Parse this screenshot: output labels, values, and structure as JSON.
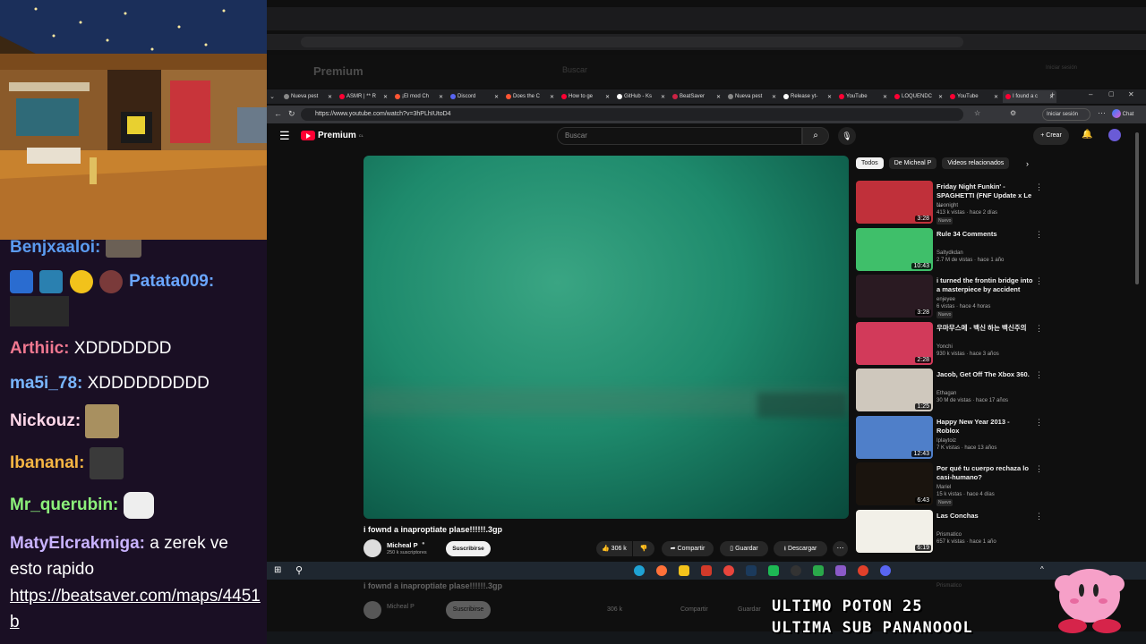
{
  "chat": {
    "messages": [
      {
        "user": "Benjxaaloi:",
        "color": "#5b9bf0",
        "text": ""
      },
      {
        "user": "Patata009:",
        "color": "#6aa6ff",
        "text": ""
      },
      {
        "user": "Arthiic:",
        "color": "#f07890",
        "text": "XDDDDDDD"
      },
      {
        "user": "ma5i_78:",
        "color": "#79b6ff",
        "text": "XDDDDDDDDD"
      },
      {
        "user": "Nickouz:",
        "color": "#ffd6e8",
        "text": ""
      },
      {
        "user": "Ibananal:",
        "color": "#f5b543",
        "text": ""
      },
      {
        "user": "Mr_querubin:",
        "color": "#8cf07a",
        "text": ""
      },
      {
        "user": "MatyElcrakmiga:",
        "color": "#c9b3ff",
        "text": "a zerek ve esto rapido"
      }
    ],
    "link": "https://beatsaver.com/maps/4451b"
  },
  "browser": {
    "tabs": [
      {
        "label": "Nueva pest",
        "color": "#888888"
      },
      {
        "label": "ASMR | ** R",
        "color": "#ff0033"
      },
      {
        "label": "¡El mod Ch",
        "color": "#ff5533"
      },
      {
        "label": "Discord",
        "color": "#5865f2"
      },
      {
        "label": "Does the C",
        "color": "#ff5533"
      },
      {
        "label": "How to ge",
        "color": "#ff0033"
      },
      {
        "label": "GitHub - Ks",
        "color": "#ffffff"
      },
      {
        "label": "BeatSaver",
        "color": "#cc2244"
      },
      {
        "label": "Nueva pest",
        "color": "#888888"
      },
      {
        "label": "Release yt-",
        "color": "#ffffff"
      },
      {
        "label": "YouTube",
        "color": "#ff0033"
      },
      {
        "label": "LOQUENDC",
        "color": "#ff0033"
      },
      {
        "label": "YouTube",
        "color": "#ff0033"
      },
      {
        "label": "I found a c",
        "color": "#ff0033"
      }
    ],
    "url": "https://www.youtube.com/watch?v=3hPLhIUtoD4",
    "signin_label": "Iniciar sesión",
    "chat_label": "Chat"
  },
  "youtube": {
    "logo_text": "Premium",
    "logo_sup": "CL",
    "search_placeholder": "Buscar",
    "create_label": "Crear",
    "video_title": "i fownd a inaproptiate plase!!!!!!.3gp",
    "channel": "Micheal P",
    "subscribers": "250 k suscriptores",
    "subscribe_label": "Suscribirse",
    "likes": "306 k",
    "share_label": "Compartir",
    "save_label": "Guardar",
    "download_label": "Descargar",
    "chips": [
      "Todos",
      "De Micheal P",
      "Videos relacionados"
    ],
    "recommendations": [
      {
        "title": "Friday Night Funkin' - SPAGHETTI (FNF Update x Le ...",
        "channel": "Neonight",
        "meta": "413 k vistas · hace 2 días",
        "duration": "3:28",
        "new": "Nuevo",
        "thumb": "#c0303a"
      },
      {
        "title": "Rule 34 Comments",
        "channel": "Saltydkdan",
        "meta": "2.7 M de vistas · hace 1 año",
        "duration": "10:43",
        "new": "",
        "thumb": "#3fbf6a"
      },
      {
        "title": "i turned the frontin bridge into a masterpiece by accident",
        "channel": "enjeyee",
        "meta": "6 vistas · hace 4 horas",
        "duration": "3:28",
        "new": "Nuevo",
        "thumb": "#2a1a22"
      },
      {
        "title": "우마무스메 - 백신 하는 백신주의",
        "channel": "Yonchi",
        "meta": "930 k vistas · hace 3 años",
        "duration": "2:28",
        "new": "",
        "thumb": "#d23a5a"
      },
      {
        "title": "Jacob, Get Off The Xbox 360.",
        "channel": "Ethagan",
        "meta": "30 M de vistas · hace 17 años",
        "duration": "1:25",
        "new": "",
        "thumb": "#cfc8bd"
      },
      {
        "title": "Happy New Year 2013 - Roblox",
        "channel": "Iplaytoiz",
        "meta": "7 K vistas · hace 13 años",
        "duration": "12:43",
        "new": "",
        "thumb": "#4f7fc9"
      },
      {
        "title": "Por qué tu cuerpo rechaza lo casi-humano?",
        "channel": "Mariel",
        "meta": "15 k vistas · hace 4 días",
        "duration": "6:43",
        "new": "Nuevo",
        "thumb": "#1a140e"
      },
      {
        "title": "Las Conchas",
        "channel": "Prismatico",
        "meta": "657 k vistas · hace 1 año",
        "duration": "6:19",
        "new": "",
        "thumb": "#f2f0e8"
      }
    ]
  },
  "ghost": {
    "title": "i fownd a inaproptiate plase!!!!!!.3gp",
    "channel": "Micheal P",
    "subscribe_label": "Suscribirse",
    "likes": "306 k",
    "share_label": "Compartir",
    "save_label": "Guardar",
    "search_placeholder": "Buscar",
    "logo_text": "Premium",
    "signin_label": "Iniciar sesión",
    "rec_channel": "Prismatico"
  },
  "overlay": {
    "line1": "ULTIMO POTON 25",
    "line2": "ULTIMA SUB PANANOOOL"
  }
}
